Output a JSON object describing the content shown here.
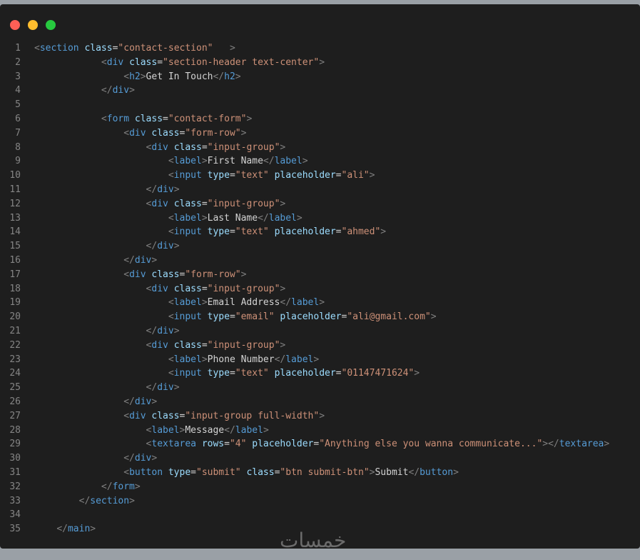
{
  "window": {
    "controls": [
      {
        "name": "close",
        "color": "#ff5f56"
      },
      {
        "name": "minimize",
        "color": "#ffbd2e"
      },
      {
        "name": "maximize",
        "color": "#27c93f"
      }
    ]
  },
  "colors": {
    "background": "#1e1e1e",
    "tag": "#569cd6",
    "attribute": "#9cdcfe",
    "string": "#ce9178",
    "text": "#d4d4d4",
    "line_number": "#858585"
  },
  "lines": [
    {
      "n": "1",
      "indent": "",
      "parts": [
        [
          "p",
          "<"
        ],
        [
          "t",
          "section"
        ],
        [
          "x",
          " "
        ],
        [
          "a",
          "class"
        ],
        [
          "x",
          "="
        ],
        [
          "s",
          "\"contact-section\""
        ],
        [
          "x",
          "   "
        ],
        [
          "p",
          ">"
        ]
      ]
    },
    {
      "n": "2",
      "indent": "            ",
      "parts": [
        [
          "p",
          "<"
        ],
        [
          "t",
          "div"
        ],
        [
          "x",
          " "
        ],
        [
          "a",
          "class"
        ],
        [
          "x",
          "="
        ],
        [
          "s",
          "\"section-header text-center\""
        ],
        [
          "p",
          ">"
        ]
      ]
    },
    {
      "n": "3",
      "indent": "                ",
      "parts": [
        [
          "p",
          "<"
        ],
        [
          "t",
          "h2"
        ],
        [
          "p",
          ">"
        ],
        [
          "x",
          "Get In Touch"
        ],
        [
          "p",
          "</"
        ],
        [
          "t",
          "h2"
        ],
        [
          "p",
          ">"
        ]
      ]
    },
    {
      "n": "4",
      "indent": "            ",
      "parts": [
        [
          "p",
          "</"
        ],
        [
          "t",
          "div"
        ],
        [
          "p",
          ">"
        ]
      ]
    },
    {
      "n": "5",
      "indent": "",
      "parts": []
    },
    {
      "n": "6",
      "indent": "            ",
      "parts": [
        [
          "p",
          "<"
        ],
        [
          "t",
          "form"
        ],
        [
          "x",
          " "
        ],
        [
          "a",
          "class"
        ],
        [
          "x",
          "="
        ],
        [
          "s",
          "\"contact-form\""
        ],
        [
          "p",
          ">"
        ]
      ]
    },
    {
      "n": "7",
      "indent": "                ",
      "parts": [
        [
          "p",
          "<"
        ],
        [
          "t",
          "div"
        ],
        [
          "x",
          " "
        ],
        [
          "a",
          "class"
        ],
        [
          "x",
          "="
        ],
        [
          "s",
          "\"form-row\""
        ],
        [
          "p",
          ">"
        ]
      ]
    },
    {
      "n": "8",
      "indent": "                    ",
      "parts": [
        [
          "p",
          "<"
        ],
        [
          "t",
          "div"
        ],
        [
          "x",
          " "
        ],
        [
          "a",
          "class"
        ],
        [
          "x",
          "="
        ],
        [
          "s",
          "\"input-group\""
        ],
        [
          "p",
          ">"
        ]
      ]
    },
    {
      "n": "9",
      "indent": "                        ",
      "parts": [
        [
          "p",
          "<"
        ],
        [
          "t",
          "label"
        ],
        [
          "p",
          ">"
        ],
        [
          "x",
          "First Name"
        ],
        [
          "p",
          "</"
        ],
        [
          "t",
          "label"
        ],
        [
          "p",
          ">"
        ]
      ]
    },
    {
      "n": "10",
      "indent": "                        ",
      "parts": [
        [
          "p",
          "<"
        ],
        [
          "t",
          "input"
        ],
        [
          "x",
          " "
        ],
        [
          "a",
          "type"
        ],
        [
          "x",
          "="
        ],
        [
          "s",
          "\"text\""
        ],
        [
          "x",
          " "
        ],
        [
          "a",
          "placeholder"
        ],
        [
          "x",
          "="
        ],
        [
          "s",
          "\"ali\""
        ],
        [
          "p",
          ">"
        ]
      ]
    },
    {
      "n": "11",
      "indent": "                    ",
      "parts": [
        [
          "p",
          "</"
        ],
        [
          "t",
          "div"
        ],
        [
          "p",
          ">"
        ]
      ]
    },
    {
      "n": "12",
      "indent": "                    ",
      "parts": [
        [
          "p",
          "<"
        ],
        [
          "t",
          "div"
        ],
        [
          "x",
          " "
        ],
        [
          "a",
          "class"
        ],
        [
          "x",
          "="
        ],
        [
          "s",
          "\"input-group\""
        ],
        [
          "p",
          ">"
        ]
      ]
    },
    {
      "n": "13",
      "indent": "                        ",
      "parts": [
        [
          "p",
          "<"
        ],
        [
          "t",
          "label"
        ],
        [
          "p",
          ">"
        ],
        [
          "x",
          "Last Name"
        ],
        [
          "p",
          "</"
        ],
        [
          "t",
          "label"
        ],
        [
          "p",
          ">"
        ]
      ]
    },
    {
      "n": "14",
      "indent": "                        ",
      "parts": [
        [
          "p",
          "<"
        ],
        [
          "t",
          "input"
        ],
        [
          "x",
          " "
        ],
        [
          "a",
          "type"
        ],
        [
          "x",
          "="
        ],
        [
          "s",
          "\"text\""
        ],
        [
          "x",
          " "
        ],
        [
          "a",
          "placeholder"
        ],
        [
          "x",
          "="
        ],
        [
          "s",
          "\"ahmed\""
        ],
        [
          "p",
          ">"
        ]
      ]
    },
    {
      "n": "15",
      "indent": "                    ",
      "parts": [
        [
          "p",
          "</"
        ],
        [
          "t",
          "div"
        ],
        [
          "p",
          ">"
        ]
      ]
    },
    {
      "n": "16",
      "indent": "                ",
      "parts": [
        [
          "p",
          "</"
        ],
        [
          "t",
          "div"
        ],
        [
          "p",
          ">"
        ]
      ]
    },
    {
      "n": "17",
      "indent": "                ",
      "parts": [
        [
          "p",
          "<"
        ],
        [
          "t",
          "div"
        ],
        [
          "x",
          " "
        ],
        [
          "a",
          "class"
        ],
        [
          "x",
          "="
        ],
        [
          "s",
          "\"form-row\""
        ],
        [
          "p",
          ">"
        ]
      ]
    },
    {
      "n": "18",
      "indent": "                    ",
      "parts": [
        [
          "p",
          "<"
        ],
        [
          "t",
          "div"
        ],
        [
          "x",
          " "
        ],
        [
          "a",
          "class"
        ],
        [
          "x",
          "="
        ],
        [
          "s",
          "\"input-group\""
        ],
        [
          "p",
          ">"
        ]
      ]
    },
    {
      "n": "19",
      "indent": "                        ",
      "parts": [
        [
          "p",
          "<"
        ],
        [
          "t",
          "label"
        ],
        [
          "p",
          ">"
        ],
        [
          "x",
          "Email Address"
        ],
        [
          "p",
          "</"
        ],
        [
          "t",
          "label"
        ],
        [
          "p",
          ">"
        ]
      ]
    },
    {
      "n": "20",
      "indent": "                        ",
      "parts": [
        [
          "p",
          "<"
        ],
        [
          "t",
          "input"
        ],
        [
          "x",
          " "
        ],
        [
          "a",
          "type"
        ],
        [
          "x",
          "="
        ],
        [
          "s",
          "\"email\""
        ],
        [
          "x",
          " "
        ],
        [
          "a",
          "placeholder"
        ],
        [
          "x",
          "="
        ],
        [
          "s",
          "\"ali@gmail.com\""
        ],
        [
          "p",
          ">"
        ]
      ]
    },
    {
      "n": "21",
      "indent": "                    ",
      "parts": [
        [
          "p",
          "</"
        ],
        [
          "t",
          "div"
        ],
        [
          "p",
          ">"
        ]
      ]
    },
    {
      "n": "22",
      "indent": "                    ",
      "parts": [
        [
          "p",
          "<"
        ],
        [
          "t",
          "div"
        ],
        [
          "x",
          " "
        ],
        [
          "a",
          "class"
        ],
        [
          "x",
          "="
        ],
        [
          "s",
          "\"input-group\""
        ],
        [
          "p",
          ">"
        ]
      ]
    },
    {
      "n": "23",
      "indent": "                        ",
      "parts": [
        [
          "p",
          "<"
        ],
        [
          "t",
          "label"
        ],
        [
          "p",
          ">"
        ],
        [
          "x",
          "Phone Number"
        ],
        [
          "p",
          "</"
        ],
        [
          "t",
          "label"
        ],
        [
          "p",
          ">"
        ]
      ]
    },
    {
      "n": "24",
      "indent": "                        ",
      "parts": [
        [
          "p",
          "<"
        ],
        [
          "t",
          "input"
        ],
        [
          "x",
          " "
        ],
        [
          "a",
          "type"
        ],
        [
          "x",
          "="
        ],
        [
          "s",
          "\"text\""
        ],
        [
          "x",
          " "
        ],
        [
          "a",
          "placeholder"
        ],
        [
          "x",
          "="
        ],
        [
          "s",
          "\"01147471624\""
        ],
        [
          "p",
          ">"
        ]
      ]
    },
    {
      "n": "25",
      "indent": "                    ",
      "parts": [
        [
          "p",
          "</"
        ],
        [
          "t",
          "div"
        ],
        [
          "p",
          ">"
        ]
      ]
    },
    {
      "n": "26",
      "indent": "                ",
      "parts": [
        [
          "p",
          "</"
        ],
        [
          "t",
          "div"
        ],
        [
          "p",
          ">"
        ]
      ]
    },
    {
      "n": "27",
      "indent": "                ",
      "parts": [
        [
          "p",
          "<"
        ],
        [
          "t",
          "div"
        ],
        [
          "x",
          " "
        ],
        [
          "a",
          "class"
        ],
        [
          "x",
          "="
        ],
        [
          "s",
          "\"input-group full-width\""
        ],
        [
          "p",
          ">"
        ]
      ]
    },
    {
      "n": "28",
      "indent": "                    ",
      "parts": [
        [
          "p",
          "<"
        ],
        [
          "t",
          "label"
        ],
        [
          "p",
          ">"
        ],
        [
          "x",
          "Message"
        ],
        [
          "p",
          "</"
        ],
        [
          "t",
          "label"
        ],
        [
          "p",
          ">"
        ]
      ]
    },
    {
      "n": "29",
      "indent": "                    ",
      "parts": [
        [
          "p",
          "<"
        ],
        [
          "t",
          "textarea"
        ],
        [
          "x",
          " "
        ],
        [
          "a",
          "rows"
        ],
        [
          "x",
          "="
        ],
        [
          "s",
          "\"4\""
        ],
        [
          "x",
          " "
        ],
        [
          "a",
          "placeholder"
        ],
        [
          "x",
          "="
        ],
        [
          "s",
          "\"Anything else you wanna communicate...\""
        ],
        [
          "p",
          ">"
        ],
        [
          "p",
          "</"
        ],
        [
          "t",
          "textarea"
        ],
        [
          "p",
          ">"
        ]
      ]
    },
    {
      "n": "30",
      "indent": "                ",
      "parts": [
        [
          "p",
          "</"
        ],
        [
          "t",
          "div"
        ],
        [
          "p",
          ">"
        ]
      ]
    },
    {
      "n": "31",
      "indent": "                ",
      "parts": [
        [
          "p",
          "<"
        ],
        [
          "t",
          "button"
        ],
        [
          "x",
          " "
        ],
        [
          "a",
          "type"
        ],
        [
          "x",
          "="
        ],
        [
          "s",
          "\"submit\""
        ],
        [
          "x",
          " "
        ],
        [
          "a",
          "class"
        ],
        [
          "x",
          "="
        ],
        [
          "s",
          "\"btn submit-btn\""
        ],
        [
          "p",
          ">"
        ],
        [
          "x",
          "Submit"
        ],
        [
          "p",
          "</"
        ],
        [
          "t",
          "button"
        ],
        [
          "p",
          ">"
        ]
      ]
    },
    {
      "n": "32",
      "indent": "            ",
      "parts": [
        [
          "p",
          "</"
        ],
        [
          "t",
          "form"
        ],
        [
          "p",
          ">"
        ]
      ]
    },
    {
      "n": "33",
      "indent": "        ",
      "parts": [
        [
          "p",
          "</"
        ],
        [
          "t",
          "section"
        ],
        [
          "p",
          ">"
        ]
      ]
    },
    {
      "n": "34",
      "indent": "",
      "parts": []
    },
    {
      "n": "35",
      "indent": "    ",
      "parts": [
        [
          "p",
          "</"
        ],
        [
          "t",
          "main"
        ],
        [
          "p",
          ">"
        ]
      ]
    }
  ],
  "watermark": "خمسات"
}
